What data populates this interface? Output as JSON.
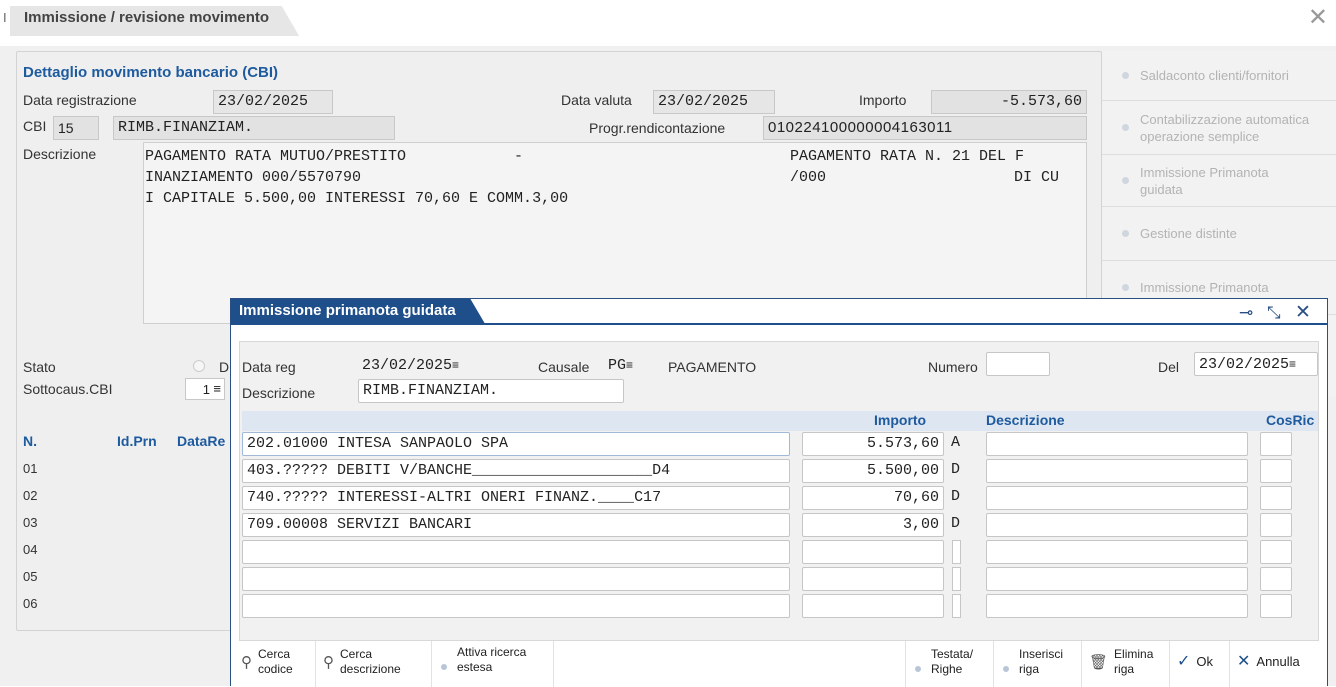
{
  "window": {
    "title": "Immissione / revisione movimento"
  },
  "detail": {
    "title": "Dettaglio movimento bancario (CBI)",
    "data_registrazione_label": "Data registrazione",
    "data_registrazione": "23/02/2025",
    "data_valuta_label": "Data valuta",
    "data_valuta": "23/02/2025",
    "importo_label": "Importo",
    "importo": "-5.573,60",
    "cbi_label": "CBI",
    "cbi_code": "15",
    "cbi_desc": "RIMB.FINANZIAM.",
    "progr_label": "Progr.rendicontazione",
    "progr": "010224100000004163011",
    "descrizione_label": "Descrizione",
    "desc_lines": [
      {
        "left": "PAGAMENTO RATA MUTUO/PRESTITO",
        "mid": "-",
        "right": "PAGAMENTO RATA N. 21 DEL F"
      },
      {
        "left": "INANZIAMENTO 000/5570790",
        "mid": "/000",
        "right": "DI CU"
      },
      {
        "left": "I CAPITALE 5.500,00 INTERESSI 70,60 E COMM.3,00",
        "mid": "",
        "right": ""
      }
    ],
    "stato_label": "Stato",
    "stato_opt": "D",
    "sottocaus_label": "Sottocaus.CBI",
    "sottocaus_value": "1",
    "grid_headers": {
      "n": "N.",
      "idprn": "Id.Prn",
      "datare": "DataRe"
    },
    "rows": [
      "01",
      "02",
      "03",
      "04",
      "05",
      "06"
    ]
  },
  "right_panel": [
    "Saldaconto clienti/fornitori",
    "Contabilizzazione automatica operazione semplice",
    "Immissione Primanota guidata",
    "Gestione distinte",
    "Immissione Primanota"
  ],
  "dialog": {
    "title": "Immissione primanota guidata",
    "data_reg_label": "Data reg",
    "data_reg": "23/02/2025",
    "causale_label": "Causale",
    "causale_code": "PG",
    "causale_desc": "PAGAMENTO",
    "numero_label": "Numero",
    "numero": "",
    "del_label": "Del",
    "del": "23/02/2025",
    "descrizione_label": "Descrizione",
    "descrizione": "RIMB.FINANZIAM.",
    "headers": {
      "importo": "Importo",
      "descrizione": "Descrizione",
      "cosric": "CosRic"
    },
    "rows": [
      {
        "conto": "202.01000 INTESA SANPAOLO SPA",
        "importo": "5.573,60",
        "ad": "A"
      },
      {
        "conto": "403.????? DEBITI V/BANCHE____________________D4",
        "importo": "5.500,00",
        "ad": "D"
      },
      {
        "conto": "740.????? INTERESSI-ALTRI ONERI FINANZ.____C17",
        "importo": "70,60",
        "ad": "D"
      },
      {
        "conto": "709.00008 SERVIZI BANCARI",
        "importo": "3,00",
        "ad": "D"
      },
      {
        "conto": "",
        "importo": "",
        "ad": ""
      },
      {
        "conto": "",
        "importo": "",
        "ad": ""
      },
      {
        "conto": "",
        "importo": "",
        "ad": ""
      }
    ],
    "toolbar": {
      "cerca_codice": [
        "Cerca",
        "codice"
      ],
      "cerca_descrizione": [
        "Cerca",
        "descrizione"
      ],
      "attiva_ricerca": [
        "Attiva ricerca",
        "estesa"
      ],
      "testata": [
        "Testata/",
        "Righe"
      ],
      "inserisci": [
        "Inserisci",
        "riga"
      ],
      "elimina": [
        "Elimina",
        "riga"
      ],
      "ok": "Ok",
      "annulla": "Annulla"
    }
  }
}
